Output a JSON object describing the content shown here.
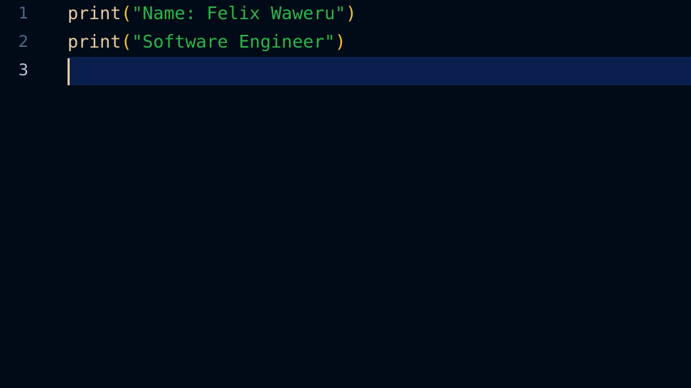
{
  "editor": {
    "lines": [
      {
        "number": "1",
        "fn": "print",
        "open": "(",
        "string": "\"Name: Felix Waweru\"",
        "close": ")"
      },
      {
        "number": "2",
        "fn": "print",
        "open": "(",
        "string": "\"Software Engineer\"",
        "close": ")"
      },
      {
        "number": "3"
      }
    ],
    "active_line": "3"
  },
  "colors": {
    "background": "#010b17",
    "line_highlight": "#0b1f4f",
    "function": "#e8c9a0",
    "paren": "#f2c12e",
    "string": "#2fb34a",
    "line_number": "#4f6a8f",
    "line_number_active": "#b8c7dd",
    "cursor": "#e8c9a0"
  }
}
